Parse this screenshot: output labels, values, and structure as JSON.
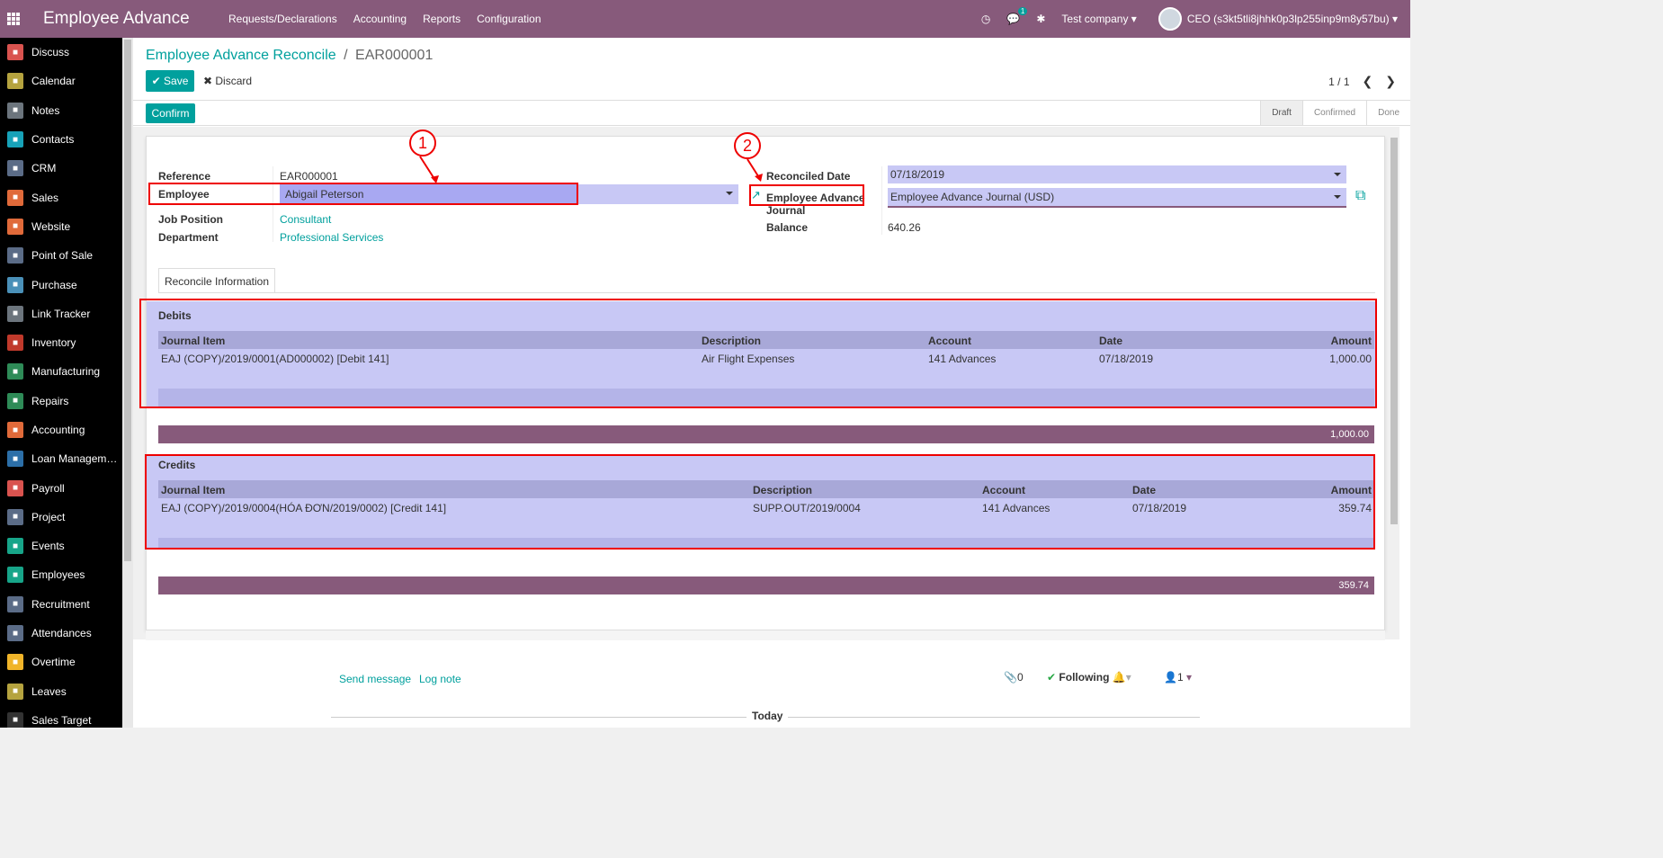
{
  "topbar": {
    "app_title": "Employee Advance",
    "menu": [
      "Requests/Declarations",
      "Accounting",
      "Reports",
      "Configuration"
    ],
    "messages_badge": "1",
    "company": "Test company",
    "user": "CEO (s3kt5tli8jhhk0p3lp255inp9m8y57bu)"
  },
  "sidebar": {
    "items": [
      {
        "label": "Discuss",
        "icon": "discuss-icon",
        "color": "#D9534F"
      },
      {
        "label": "Calendar",
        "icon": "calendar-icon",
        "color": "#B5A33F"
      },
      {
        "label": "Notes",
        "icon": "notes-icon",
        "color": "#6C757D"
      },
      {
        "label": "Contacts",
        "icon": "contacts-icon",
        "color": "#17A2B8"
      },
      {
        "label": "CRM",
        "icon": "crm-icon",
        "color": "#5B6C87"
      },
      {
        "label": "Sales",
        "icon": "sales-icon",
        "color": "#E06A3A"
      },
      {
        "label": "Website",
        "icon": "website-icon",
        "color": "#E06A3A"
      },
      {
        "label": "Point of Sale",
        "icon": "pos-icon",
        "color": "#5B6C87"
      },
      {
        "label": "Purchase",
        "icon": "purchase-icon",
        "color": "#4A90B8"
      },
      {
        "label": "Link Tracker",
        "icon": "link-tracker-icon",
        "color": "#6C757D"
      },
      {
        "label": "Inventory",
        "icon": "inventory-icon",
        "color": "#C0392B"
      },
      {
        "label": "Manufacturing",
        "icon": "manufacturing-icon",
        "color": "#2E8B57"
      },
      {
        "label": "Repairs",
        "icon": "repairs-icon",
        "color": "#2E8B57"
      },
      {
        "label": "Accounting",
        "icon": "accounting-icon",
        "color": "#E06A3A"
      },
      {
        "label": "Loan Managem…",
        "icon": "loan-icon",
        "color": "#2C6FA8"
      },
      {
        "label": "Payroll",
        "icon": "payroll-icon",
        "color": "#D9534F"
      },
      {
        "label": "Project",
        "icon": "project-icon",
        "color": "#5B6C87"
      },
      {
        "label": "Events",
        "icon": "events-icon",
        "color": "#17A589"
      },
      {
        "label": "Employees",
        "icon": "employees-icon",
        "color": "#17A589"
      },
      {
        "label": "Recruitment",
        "icon": "recruitment-icon",
        "color": "#5B6C87"
      },
      {
        "label": "Attendances",
        "icon": "attendances-icon",
        "color": "#5B6C87"
      },
      {
        "label": "Overtime",
        "icon": "overtime-icon",
        "color": "#F0B429"
      },
      {
        "label": "Leaves",
        "icon": "leaves-icon",
        "color": "#B5A33F"
      },
      {
        "label": "Sales Target",
        "icon": "sales-target-icon",
        "color": "#333"
      }
    ]
  },
  "control_panel": {
    "breadcrumb_parent": "Employee Advance Reconcile",
    "breadcrumb_sep": "/",
    "breadcrumb_current": "EAR000001",
    "save_label": "Save",
    "discard_label": "Discard",
    "pager": "1 / 1"
  },
  "status": {
    "confirm_label": "Confirm",
    "states": [
      "Draft",
      "Confirmed",
      "Done"
    ]
  },
  "form": {
    "reference_label": "Reference",
    "reference_value": "EAR000001",
    "employee_label": "Employee",
    "employee_value": "Abigail Peterson",
    "job_position_label": "Job Position",
    "job_position_value": "Consultant",
    "department_label": "Department",
    "department_value": "Professional Services",
    "reconciled_date_label": "Reconciled Date",
    "reconciled_date_value": "07/18/2019",
    "journal_label_line1": "Employee Advance",
    "journal_label_line2": "Journal",
    "journal_value": "Employee Advance Journal (USD)",
    "balance_label": "Balance",
    "balance_value": "640.26"
  },
  "annotations": [
    "1",
    "2"
  ],
  "tab_label": "Reconcile Information",
  "debits": {
    "title": "Debits",
    "headers": [
      "Journal Item",
      "Description",
      "Account",
      "Date",
      "Amount"
    ],
    "rows": [
      [
        "EAJ (COPY)/2019/0001(AD000002) [Debit 141]",
        "Air Flight Expenses",
        "141 Advances",
        "07/18/2019",
        "1,000.00"
      ]
    ],
    "total": "1,000.00"
  },
  "credits": {
    "title": "Credits",
    "headers": [
      "Journal Item",
      "Description",
      "Account",
      "Date",
      "Amount"
    ],
    "rows": [
      [
        "EAJ (COPY)/2019/0004(HÓA ĐƠN/2019/0002) [Credit 141]",
        "SUPP.OUT/2019/0004",
        "141 Advances",
        "07/18/2019",
        "359.74"
      ]
    ],
    "total": "359.74"
  },
  "chatter": {
    "send_message": "Send message",
    "log_note": "Log note",
    "attachments_count": "0",
    "following": "Following",
    "followers_count": "1",
    "today": "Today"
  }
}
